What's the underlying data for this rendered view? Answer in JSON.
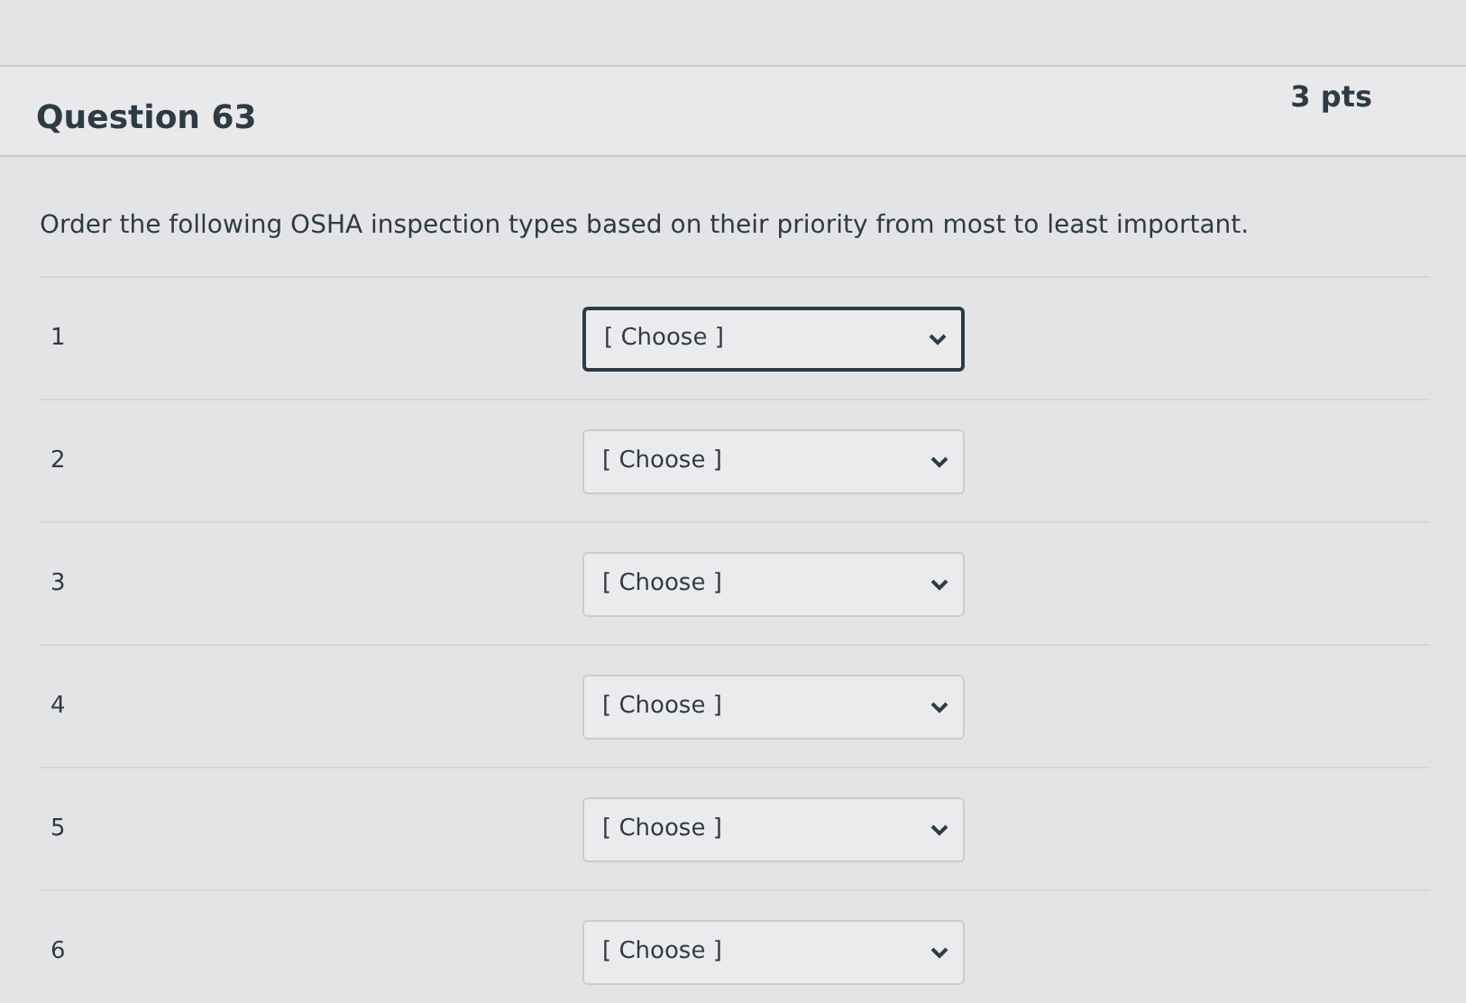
{
  "question": {
    "title": "Question 63",
    "points": "3 pts"
  },
  "prompt": "Order the following OSHA inspection types based on their priority from most to least important.",
  "rows": [
    {
      "number": "1",
      "select": {
        "value": "[ Choose ]",
        "focused": true
      }
    },
    {
      "number": "2",
      "select": {
        "value": "[ Choose ]",
        "focused": false
      }
    },
    {
      "number": "3",
      "select": {
        "value": "[ Choose ]",
        "focused": false
      }
    },
    {
      "number": "4",
      "select": {
        "value": "[ Choose ]",
        "focused": false
      }
    },
    {
      "number": "5",
      "select": {
        "value": "[ Choose ]",
        "focused": false
      }
    },
    {
      "number": "6",
      "select": {
        "value": "[ Choose ]",
        "focused": false
      }
    }
  ]
}
